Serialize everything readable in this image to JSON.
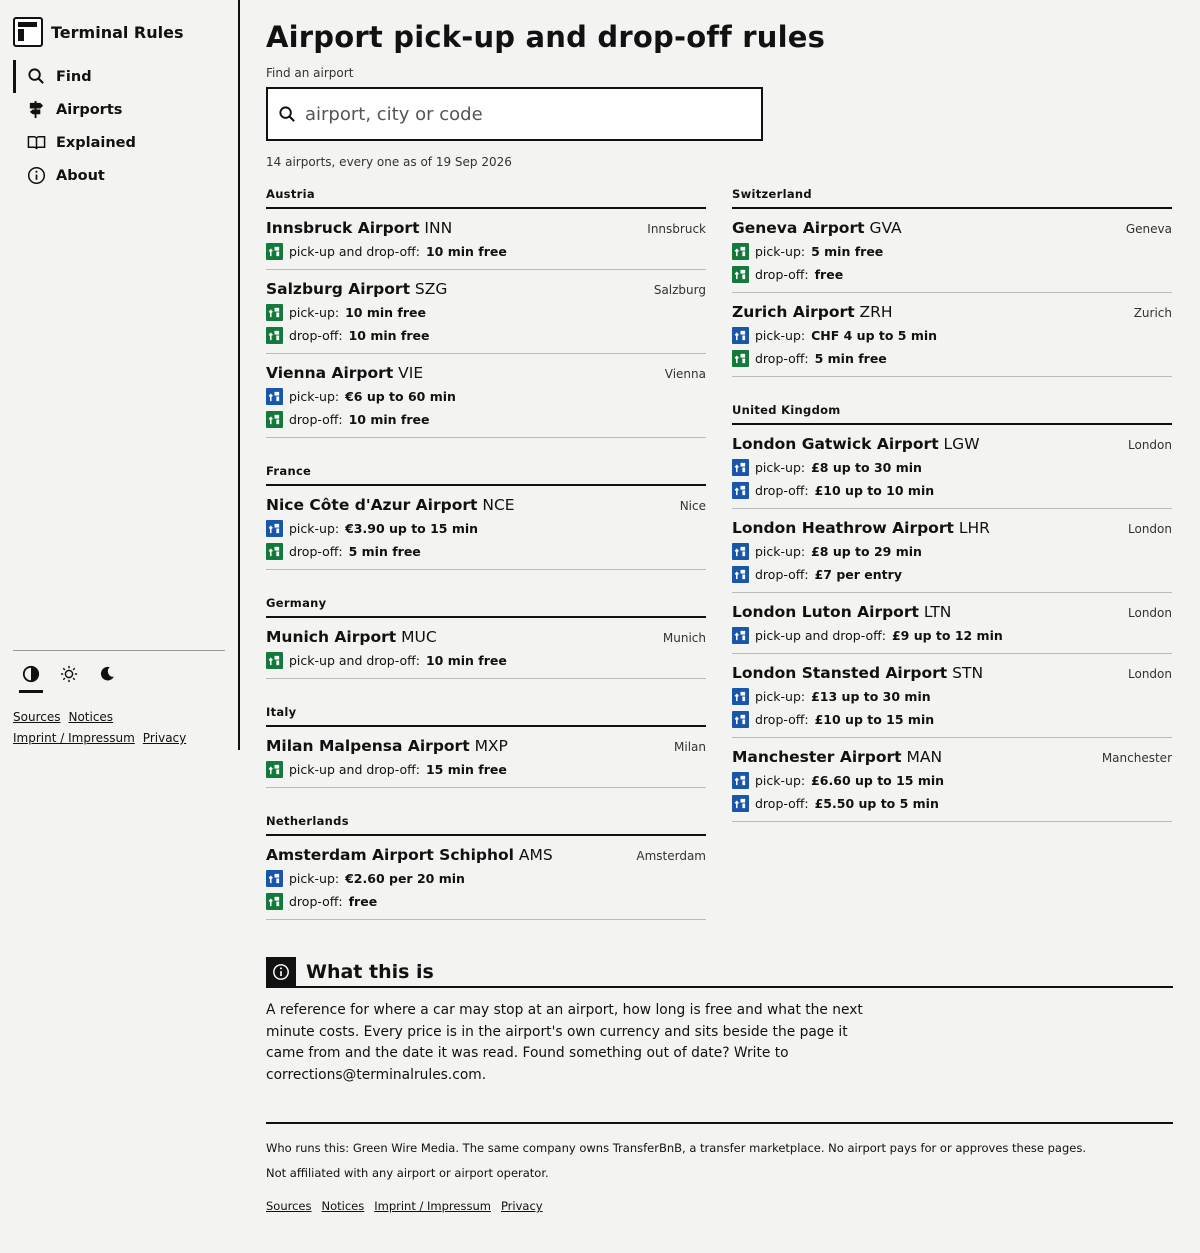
{
  "brand": {
    "name": "Terminal Rules"
  },
  "nav": [
    {
      "label": "Find",
      "icon": "search-icon"
    },
    {
      "label": "Airports",
      "icon": "signpost-icon"
    },
    {
      "label": "Explained",
      "icon": "book-icon"
    },
    {
      "label": "About",
      "icon": "info-icon"
    }
  ],
  "themes": [
    "contrast-icon",
    "sun-icon",
    "moon-icon"
  ],
  "sidebar_links": [
    "Sources",
    "Notices",
    "Imprint / Impressum",
    "Privacy"
  ],
  "page": {
    "title": "Airport pick-up and drop-off rules",
    "search_label": "Find an airport",
    "search_placeholder": "airport, city or code",
    "count": "14 airports, every one as of 19 Sep 2026"
  },
  "colors": {
    "free": "#137a3c",
    "paid": "#1756a8"
  },
  "left": [
    {
      "country": "Austria",
      "airports": [
        {
          "name": "Innsbruck Airport",
          "code": "INN",
          "city": "Innsbruck",
          "rules": [
            {
              "type": "free",
              "label": "pick-up and drop-off:",
              "value": "10 min free"
            }
          ]
        },
        {
          "name": "Salzburg Airport",
          "code": "SZG",
          "city": "Salzburg",
          "rules": [
            {
              "type": "free",
              "label": "pick-up:",
              "value": "10 min free"
            },
            {
              "type": "free",
              "label": "drop-off:",
              "value": "10 min free"
            }
          ]
        },
        {
          "name": "Vienna Airport",
          "code": "VIE",
          "city": "Vienna",
          "rules": [
            {
              "type": "paid",
              "label": "pick-up:",
              "value": "€6 up to 60 min"
            },
            {
              "type": "free",
              "label": "drop-off:",
              "value": "10 min free"
            }
          ]
        }
      ]
    },
    {
      "country": "France",
      "airports": [
        {
          "name": "Nice Côte d'Azur Airport",
          "code": "NCE",
          "city": "Nice",
          "rules": [
            {
              "type": "paid",
              "label": "pick-up:",
              "value": "€3.90 up to 15 min"
            },
            {
              "type": "free",
              "label": "drop-off:",
              "value": "5 min free"
            }
          ]
        }
      ]
    },
    {
      "country": "Germany",
      "airports": [
        {
          "name": "Munich Airport",
          "code": "MUC",
          "city": "Munich",
          "rules": [
            {
              "type": "free",
              "label": "pick-up and drop-off:",
              "value": "10 min free"
            }
          ]
        }
      ]
    },
    {
      "country": "Italy",
      "airports": [
        {
          "name": "Milan Malpensa Airport",
          "code": "MXP",
          "city": "Milan",
          "rules": [
            {
              "type": "free",
              "label": "pick-up and drop-off:",
              "value": "15 min free"
            }
          ]
        }
      ]
    },
    {
      "country": "Netherlands",
      "airports": [
        {
          "name": "Amsterdam Airport Schiphol",
          "code": "AMS",
          "city": "Amsterdam",
          "rules": [
            {
              "type": "paid",
              "label": "pick-up:",
              "value": "€2.60 per 20 min"
            },
            {
              "type": "free",
              "label": "drop-off:",
              "value": "free"
            }
          ]
        }
      ]
    }
  ],
  "right": [
    {
      "country": "Switzerland",
      "airports": [
        {
          "name": "Geneva Airport",
          "code": "GVA",
          "city": "Geneva",
          "rules": [
            {
              "type": "free",
              "label": "pick-up:",
              "value": "5 min free"
            },
            {
              "type": "free",
              "label": "drop-off:",
              "value": "free"
            }
          ]
        },
        {
          "name": "Zurich Airport",
          "code": "ZRH",
          "city": "Zurich",
          "rules": [
            {
              "type": "paid",
              "label": "pick-up:",
              "value": "CHF 4 up to 5 min"
            },
            {
              "type": "free",
              "label": "drop-off:",
              "value": "5 min free"
            }
          ]
        }
      ]
    },
    {
      "country": "United Kingdom",
      "airports": [
        {
          "name": "London Gatwick Airport",
          "code": "LGW",
          "city": "London",
          "rules": [
            {
              "type": "paid",
              "label": "pick-up:",
              "value": "£8 up to 30 min"
            },
            {
              "type": "paid",
              "label": "drop-off:",
              "value": "£10 up to 10 min"
            }
          ]
        },
        {
          "name": "London Heathrow Airport",
          "code": "LHR",
          "city": "London",
          "rules": [
            {
              "type": "paid",
              "label": "pick-up:",
              "value": "£8 up to 29 min"
            },
            {
              "type": "paid",
              "label": "drop-off:",
              "value": "£7 per entry"
            }
          ]
        },
        {
          "name": "London Luton Airport",
          "code": "LTN",
          "city": "London",
          "rules": [
            {
              "type": "paid",
              "label": "pick-up and drop-off:",
              "value": "£9 up to 12 min"
            }
          ]
        },
        {
          "name": "London Stansted Airport",
          "code": "STN",
          "city": "London",
          "rules": [
            {
              "type": "paid",
              "label": "pick-up:",
              "value": "£13 up to 30 min"
            },
            {
              "type": "paid",
              "label": "drop-off:",
              "value": "£10 up to 15 min"
            }
          ]
        },
        {
          "name": "Manchester Airport",
          "code": "MAN",
          "city": "Manchester",
          "rules": [
            {
              "type": "paid",
              "label": "pick-up:",
              "value": "£6.60 up to 15 min"
            },
            {
              "type": "paid",
              "label": "drop-off:",
              "value": "£5.50 up to 5 min"
            }
          ]
        }
      ]
    }
  ],
  "about": {
    "title": "What this is",
    "text": "A reference for where a car may stop at an airport, how long is free and what the next minute costs. Every price is in the airport's own currency and sits beside the page it came from and the date it was read. Found something out of date? Write to ",
    "email": "corrections@terminalrules.com",
    "end": "."
  },
  "footer": {
    "line1": "Who runs this: Green Wire Media. The same company owns TransferBnB, a transfer marketplace. No airport pays for or approves these pages.",
    "line2": "Not affiliated with any airport or airport operator.",
    "links": [
      "Sources",
      "Notices",
      "Imprint / Impressum",
      "Privacy"
    ]
  }
}
